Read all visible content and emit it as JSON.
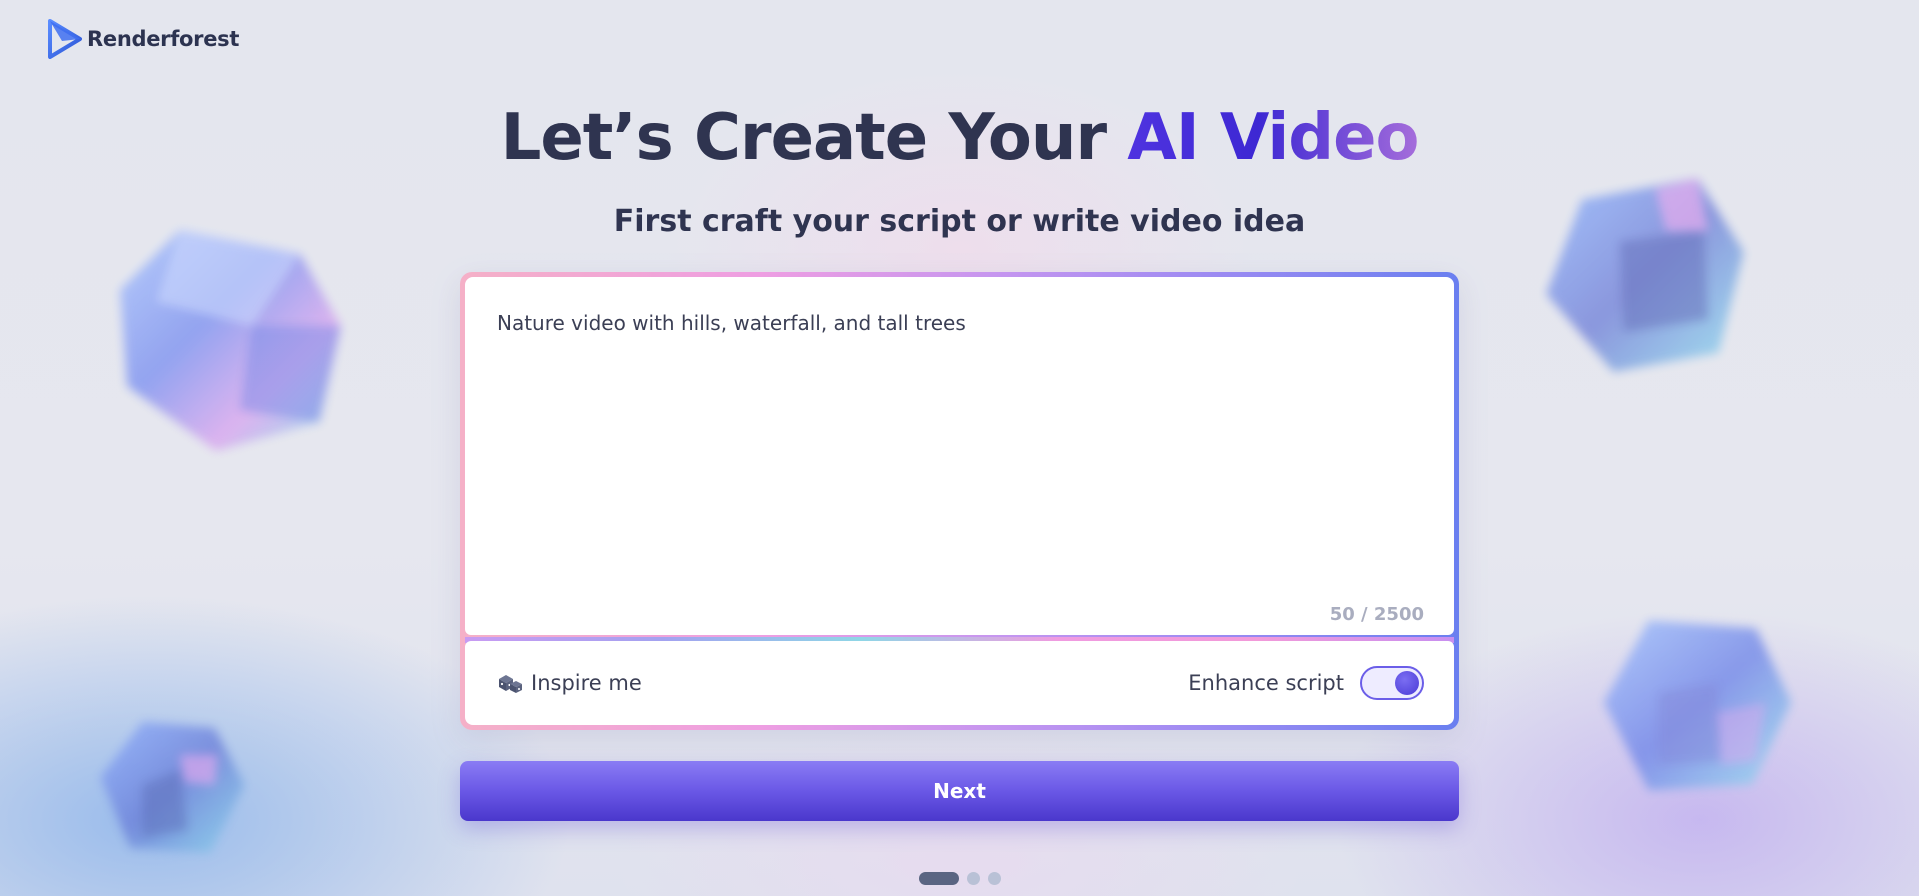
{
  "brand": {
    "name": "Renderforest"
  },
  "heading": {
    "title_main": "Let’s Create Your ",
    "title_accent": "AI Video",
    "subtitle": "First craft your script or write video idea"
  },
  "editor": {
    "script_text": "Nature video with hills, waterfall, and tall trees",
    "char_count": "50 / 2500"
  },
  "toolbar": {
    "inspire_label": "Inspire me",
    "inspire_icon": "dice-icon",
    "enhance_label": "Enhance script",
    "enhance_enabled": true
  },
  "actions": {
    "next_label": "Next"
  },
  "pagination": {
    "total_steps": 3,
    "current_step": 1
  },
  "colors": {
    "accent": "#4f33e0",
    "text_primary": "#2f3450",
    "button": "#6a58e6"
  }
}
